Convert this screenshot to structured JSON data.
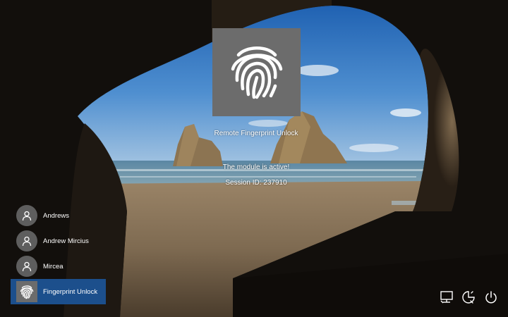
{
  "lock_screen": {
    "title": "Remote Fingerprint Unlock",
    "status": "The module is active!",
    "session": "Session ID: 237910",
    "tile_icon": "fingerprint-icon"
  },
  "users": [
    {
      "name": "Andrews",
      "icon": "user-icon",
      "selected": false
    },
    {
      "name": "Andrew Mircius",
      "icon": "user-icon",
      "selected": false
    },
    {
      "name": "Mircea",
      "icon": "user-icon",
      "selected": false
    },
    {
      "name": "Fingerprint Unlock",
      "icon": "fingerprint-icon",
      "selected": true
    }
  ],
  "corner_icons": [
    "network-icon",
    "accessibility-icon",
    "power-icon"
  ],
  "colors": {
    "selected_user": "#1c4f8c",
    "tile": "#6c6c6c",
    "text": "#ffffff"
  }
}
